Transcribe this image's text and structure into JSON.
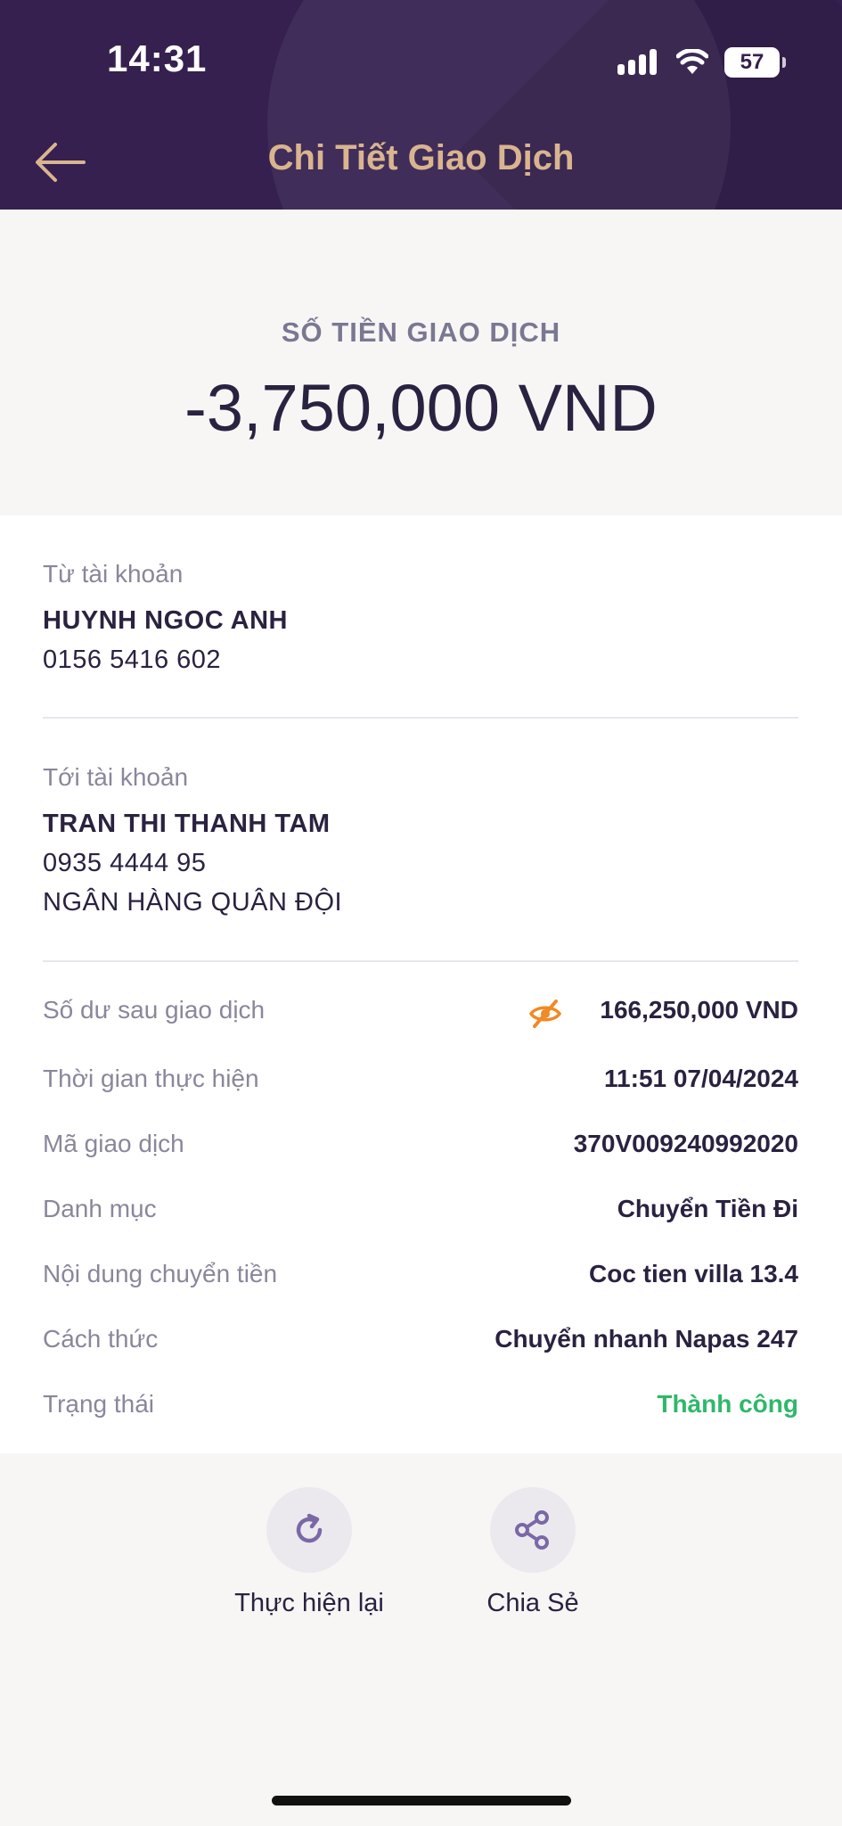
{
  "status_bar": {
    "time": "14:31",
    "battery": "57"
  },
  "header": {
    "title": "Chi Tiết Giao Dịch"
  },
  "amount": {
    "label": "SỐ TIỀN GIAO DỊCH",
    "value": "-3,750,000 VND"
  },
  "from_account": {
    "label": "Từ tài khoản",
    "name": "HUYNH NGOC ANH",
    "number": "0156 5416 602"
  },
  "to_account": {
    "label": "Tới tài khoản",
    "name": "TRAN THI THANH TAM",
    "number": "0935 4444 95",
    "bank": "NGÂN HÀNG QUÂN ĐỘI"
  },
  "details": [
    {
      "label": "Số dư sau giao dịch",
      "value": "166,250,000 VND"
    },
    {
      "label": "Thời gian thực hiện",
      "value": "11:51 07/04/2024"
    },
    {
      "label": "Mã giao dịch",
      "value": "370V009240992020"
    },
    {
      "label": "Danh mục",
      "value": "Chuyển Tiền Đi"
    },
    {
      "label": "Nội dung chuyển tiền",
      "value": "Coc tien villa 13.4"
    },
    {
      "label": "Cách thức",
      "value": "Chuyển nhanh Napas 247"
    },
    {
      "label": "Trạng thái",
      "value": "Thành công"
    }
  ],
  "actions": {
    "retry_label": "Thực hiện lại",
    "share_label": "Chia Sẻ"
  },
  "colors": {
    "header_bg": "#35204f",
    "title": "#d9b48f",
    "success": "#2fb86a",
    "eye_icon": "#f08a24"
  },
  "icons": [
    "back-arrow-icon",
    "signal-icon",
    "wifi-icon",
    "battery-icon",
    "eye-off-icon",
    "refresh-icon",
    "share-icon"
  ]
}
